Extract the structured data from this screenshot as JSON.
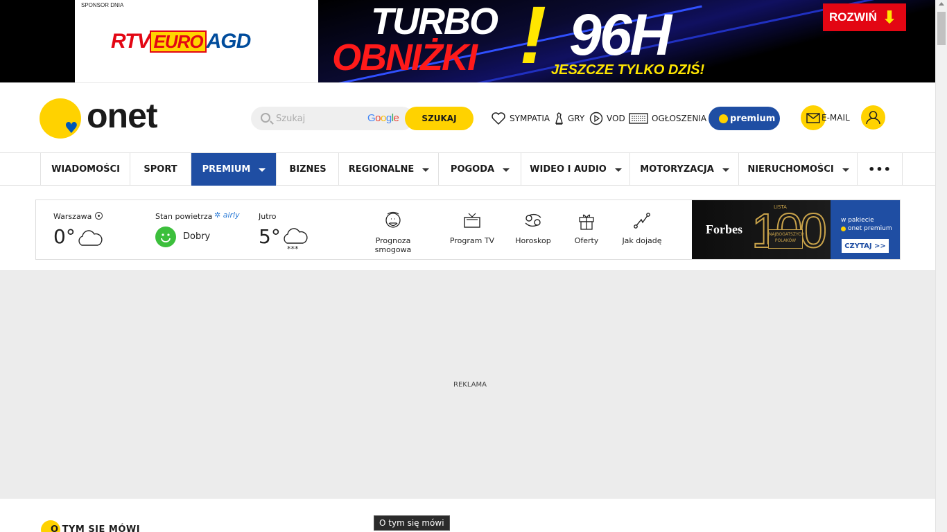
{
  "banner": {
    "sponsor_label": "SPONSOR DNIA",
    "sponsor_logo": {
      "rtv": "RTV",
      "euro": "EURO",
      "agd": "AGD"
    },
    "promo": {
      "turbo": "TURBO",
      "obnizki": "OBNIŻKI",
      "exclamation": "!",
      "hours": "96H",
      "tagline": "JESZCZE TYLKO DZIŚ!",
      "expand_label": "ROZWIŃ",
      "expand_arrow": "➔"
    }
  },
  "header": {
    "logo_text": "onet",
    "search": {
      "placeholder": "Szukaj",
      "google_label": "Google",
      "button_label": "SZUKAJ"
    },
    "links": [
      {
        "label": "SYMPATIA",
        "icon": "heart-icon"
      },
      {
        "label": "GRY",
        "icon": "chess-piece-icon"
      },
      {
        "label": "VOD",
        "icon": "play-circle-icon"
      },
      {
        "label": "OGŁOSZENIA",
        "icon": "keyboard-icon"
      }
    ],
    "premium_label": "premium",
    "mail_label": "E-MAIL"
  },
  "nav": {
    "items": [
      {
        "label": "WIADOMOŚCI",
        "dropdown": false
      },
      {
        "label": "SPORT",
        "dropdown": false
      },
      {
        "label": "PREMIUM",
        "dropdown": true,
        "active": true
      },
      {
        "label": "BIZNES",
        "dropdown": false
      },
      {
        "label": "REGIONALNE",
        "dropdown": true
      },
      {
        "label": "POGODA",
        "dropdown": true
      },
      {
        "label": "WIDEO I AUDIO",
        "dropdown": true
      },
      {
        "label": "MOTORYZACJA",
        "dropdown": true
      },
      {
        "label": "NIERUCHOMOŚCI",
        "dropdown": true
      }
    ],
    "more_label": "•••"
  },
  "services": {
    "weather": {
      "city": "Warszawa",
      "temp": "0°",
      "condition_icon": "cloud-icon"
    },
    "air": {
      "label": "Stan powietrza",
      "provider": "airly",
      "status": "Dobry",
      "status_color": "#3cbf3c"
    },
    "tomorrow": {
      "label": "Jutro",
      "temp": "5°",
      "condition_icon": "snow-cloud-icon"
    },
    "items": [
      {
        "label": "Prognoza smogowa",
        "icon": "smog-mask-icon"
      },
      {
        "label": "Program TV",
        "icon": "tv-icon"
      },
      {
        "label": "Horoskop",
        "icon": "cancer-zodiac-icon"
      },
      {
        "label": "Oferty",
        "icon": "gift-icon"
      },
      {
        "label": "Jak dojadę",
        "icon": "route-icon"
      }
    ],
    "forbes_ad": {
      "brand": "Forbes",
      "lista": "LISTA",
      "number": "100",
      "sub": "NAJBOGATSZYCH POLAKÓW",
      "in_package": "w pakiecie",
      "onet_premium": "onet premium",
      "cta": "CZYTAJ >>"
    }
  },
  "ad": {
    "label": "REKLAMA"
  },
  "bottom": {
    "section_title": "O TYM SIĘ MÓWI",
    "tooltip": "O tym się mówi"
  },
  "colors": {
    "brand_yellow": "#ffd200",
    "premium_blue": "#1f4ea3",
    "promo_red": "#e30613"
  }
}
